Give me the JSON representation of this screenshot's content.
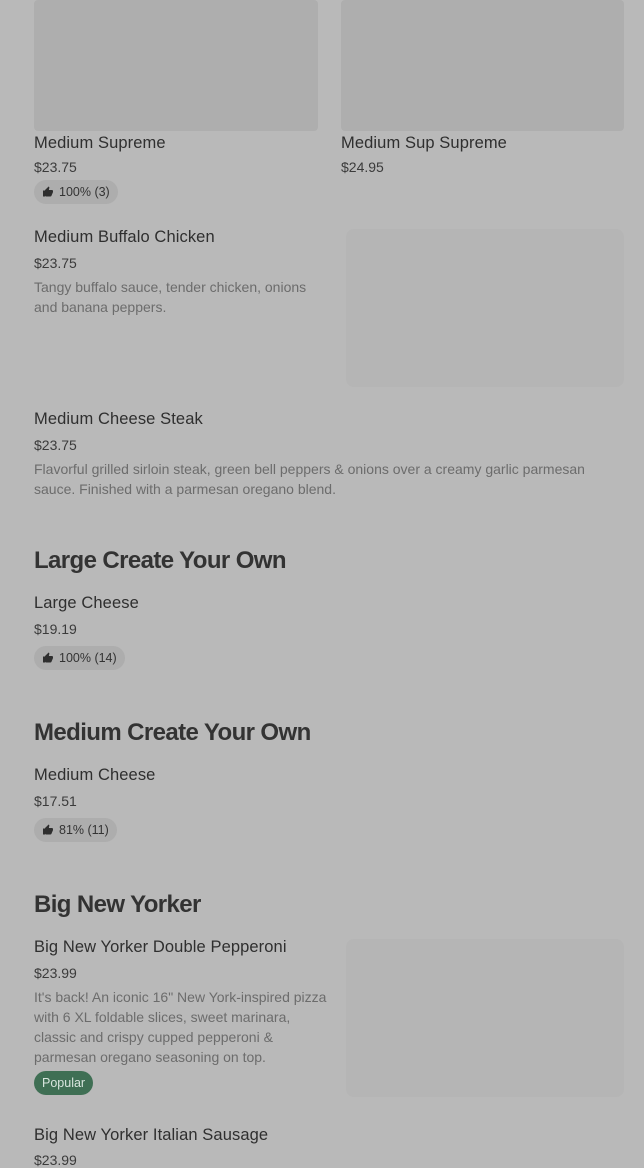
{
  "items": {
    "medium_supreme": {
      "name": "Medium Supreme",
      "price": "$23.75",
      "rating": "100% (3)"
    },
    "medium_sup_supreme": {
      "name": "Medium Sup Supreme",
      "price": "$24.95"
    },
    "medium_buffalo_chicken": {
      "name": "Medium Buffalo Chicken",
      "price": "$23.75",
      "description": "Tangy buffalo sauce, tender chicken, onions and banana peppers."
    },
    "medium_cheese_steak": {
      "name": "Medium Cheese Steak",
      "price": "$23.75",
      "description": "Flavorful grilled sirloin steak, green bell peppers & onions over a creamy garlic parmesan sauce. Finished with a parmesan oregano blend."
    },
    "large_cheese": {
      "name": "Large Cheese",
      "price": "$19.19",
      "rating": "100% (14)"
    },
    "medium_cheese": {
      "name": "Medium Cheese",
      "price": "$17.51",
      "rating": "81% (11)"
    },
    "big_new_yorker_double_pepperoni": {
      "name": "Big New Yorker Double Pepperoni",
      "price": "$23.99",
      "description": "It's back! An iconic 16\" New York-inspired pizza with 6 XL foldable slices, sweet marinara, classic and crispy cupped pepperoni & parmesan oregano seasoning on top.",
      "badge": "Popular"
    },
    "big_new_yorker_italian_sausage": {
      "name": "Big New Yorker Italian Sausage",
      "price": "$23.99"
    }
  },
  "sections": {
    "large_create": "Large Create Your Own",
    "medium_create": "Medium Create Your Own",
    "big_new_yorker": "Big New Yorker"
  },
  "icons": {
    "rating": "thumbs-up-icon"
  },
  "colors": {
    "background": "#b9b9b9",
    "badge_popular": "#3f6f54"
  }
}
